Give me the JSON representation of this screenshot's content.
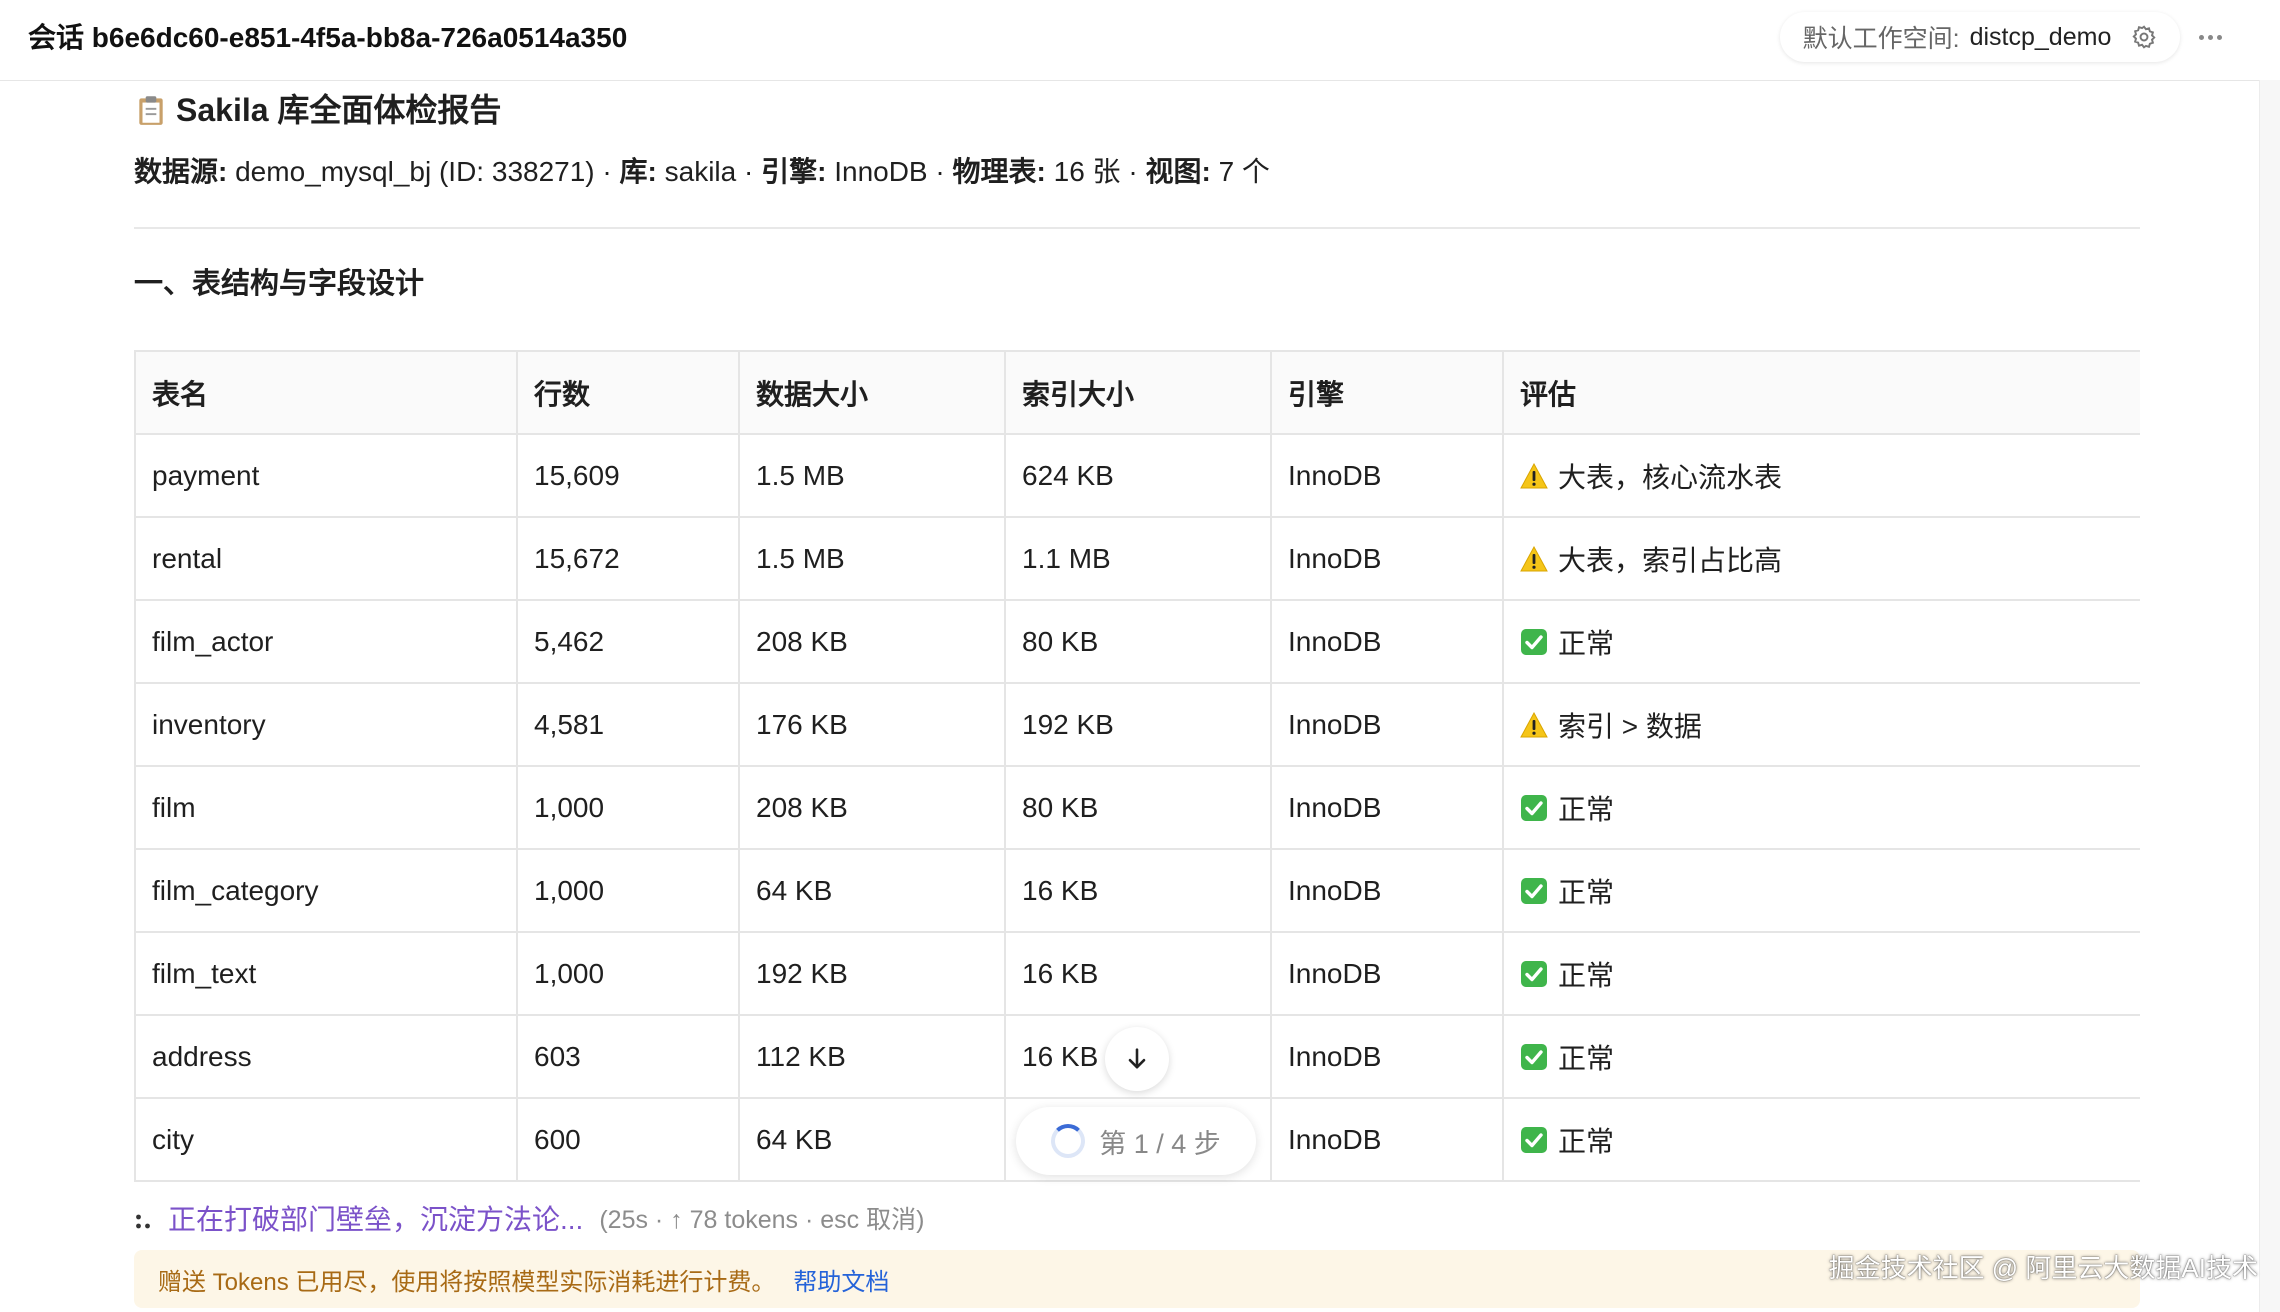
{
  "header": {
    "session_title": "会话 b6e6dc60-e851-4f5a-bb8a-726a0514a350",
    "workspace_label": "默认工作空间:",
    "workspace_value": "distcp_demo",
    "settings_icon": "gear-icon",
    "more_icon": "more-horizontal-icon"
  },
  "report": {
    "title": "Sakila 库全面体检报告",
    "title_icon": "clipboard-icon",
    "meta": {
      "source_label": "数据源:",
      "source_value": "demo_mysql_bj (ID: 338271)",
      "db_label": "库:",
      "db_value": "sakila",
      "engine_label": "引擎:",
      "engine_value": "InnoDB",
      "tables_label": "物理表:",
      "tables_value": "16 张",
      "views_label": "视图:",
      "views_value": "7 个",
      "sep": " · "
    },
    "section_title": "一、表结构与字段设计"
  },
  "table": {
    "headers": [
      "表名",
      "行数",
      "数据大小",
      "索引大小",
      "引擎",
      "评估"
    ],
    "rows": [
      {
        "name": "payment",
        "rows": "15,609",
        "data": "1.5 MB",
        "index": "624 KB",
        "engine": "InnoDB",
        "status_icon": "warning-icon",
        "status": "大表，核心流水表"
      },
      {
        "name": "rental",
        "rows": "15,672",
        "data": "1.5 MB",
        "index": "1.1 MB",
        "engine": "InnoDB",
        "status_icon": "warning-icon",
        "status": "大表，索引占比高"
      },
      {
        "name": "film_actor",
        "rows": "5,462",
        "data": "208 KB",
        "index": "80 KB",
        "engine": "InnoDB",
        "status_icon": "check-icon",
        "status": "正常"
      },
      {
        "name": "inventory",
        "rows": "4,581",
        "data": "176 KB",
        "index": "192 KB",
        "engine": "InnoDB",
        "status_icon": "warning-icon",
        "status": "索引 > 数据"
      },
      {
        "name": "film",
        "rows": "1,000",
        "data": "208 KB",
        "index": "80 KB",
        "engine": "InnoDB",
        "status_icon": "check-icon",
        "status": "正常"
      },
      {
        "name": "film_category",
        "rows": "1,000",
        "data": "64 KB",
        "index": "16 KB",
        "engine": "InnoDB",
        "status_icon": "check-icon",
        "status": "正常"
      },
      {
        "name": "film_text",
        "rows": "1,000",
        "data": "192 KB",
        "index": "16 KB",
        "engine": "InnoDB",
        "status_icon": "check-icon",
        "status": "正常"
      },
      {
        "name": "address",
        "rows": "603",
        "data": "112 KB",
        "index": "16 KB",
        "engine": "InnoDB",
        "status_icon": "check-icon",
        "status": "正常"
      },
      {
        "name": "city",
        "rows": "600",
        "data": "64 KB",
        "index": "",
        "engine": "InnoDB",
        "status_icon": "check-icon",
        "status": "正常"
      }
    ]
  },
  "controls": {
    "scroll_down_icon": "arrow-down-icon",
    "step_text": "第 1 / 4 步"
  },
  "progress": {
    "text": "正在打破部门壁垒，沉淀方法论...",
    "meta": "(25s · ↑ 78 tokens · esc 取消)"
  },
  "notice": {
    "text": "赠送 Tokens 已用尽，使用将按照模型实际消耗进行计费。",
    "link": "帮助文档"
  },
  "watermark": "掘金技术社区 @ 阿里云大数据AI技术"
}
